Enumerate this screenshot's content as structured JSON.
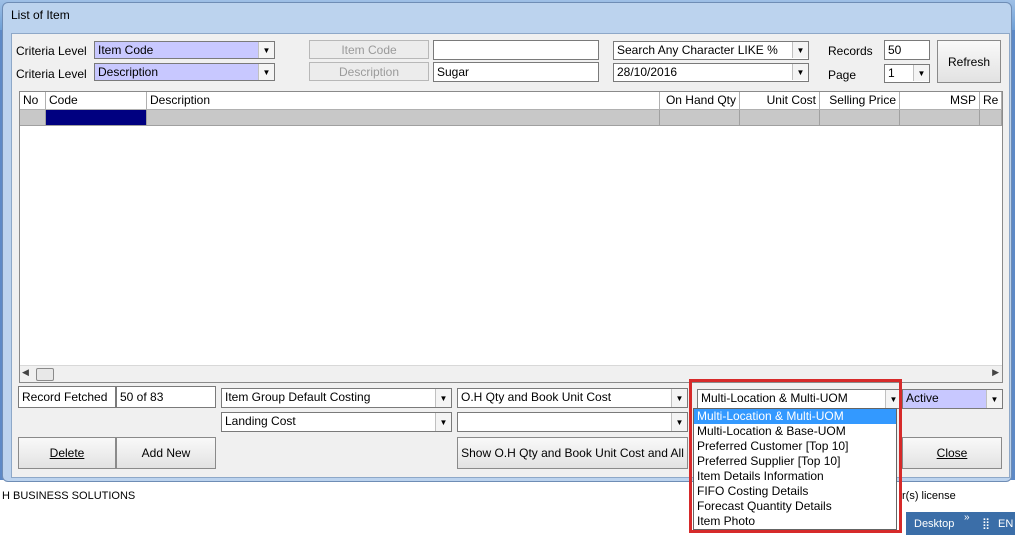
{
  "window": {
    "title": "List of Item"
  },
  "criteria": {
    "label1": "Criteria Level",
    "label2": "Criteria Level",
    "level1_value": "Item Code",
    "level2_value": "Description",
    "field1_button": "Item Code",
    "field2_button": "Description",
    "field1_value": "",
    "field2_value": "Sugar",
    "search_mode": "Search Any Character LIKE %",
    "date": "28/10/2016",
    "records_label": "Records",
    "records_value": "50",
    "page_label": "Page",
    "page_value": "1",
    "refresh_label": "Refresh"
  },
  "grid": {
    "columns": [
      "No",
      "Code",
      "Description",
      "On Hand Qty",
      "Unit Cost",
      "Selling Price",
      "MSP",
      "Re"
    ]
  },
  "footer": {
    "record_fetched_label": "Record Fetched",
    "record_fetched_value": "50 of 83",
    "costing_combo": "Item Group Default Costing",
    "landing_combo": "Landing Cost",
    "qty_combo": "O.H Qty and Book Unit Cost",
    "qty_combo2": "",
    "location_combo": "Multi-Location & Multi-UOM",
    "status_combo": "Active",
    "delete_label": "Delete",
    "add_new_label": "Add New",
    "show_all_label": "Show O.H Qty and Book Unit Cost and All",
    "close_label": "Close"
  },
  "dropdown": {
    "options": [
      "Multi-Location & Multi-UOM",
      "Multi-Location & Base-UOM",
      "Preferred Customer [Top 10]",
      "Preferred Supplier [Top 10]",
      "Item Details Information",
      "FIFO Costing Details",
      "Forecast Quantity Details",
      "Item Photo"
    ],
    "selected_index": 0
  },
  "background": {
    "company": "H BUSINESS SOLUTIONS",
    "license_text": "r(s) license",
    "desktop_label": "Desktop",
    "lang": "EN"
  },
  "colors": {
    "highlight": "#c8c8ff",
    "selection": "#3399ff",
    "callout": "#d62a2a",
    "code_cell": "#000080"
  }
}
